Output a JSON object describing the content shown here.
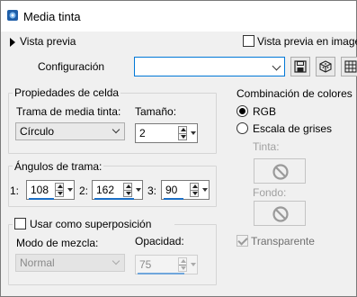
{
  "window": {
    "title": "Media tinta"
  },
  "preview": {
    "toggle_label": "Vista previa",
    "checkbox_label": "Vista previa en imagen"
  },
  "config": {
    "label": "Configuración",
    "value": ""
  },
  "cell_props": {
    "title": "Propiedades de celda",
    "trama_label": "Trama de media tinta:",
    "trama_value": "Círculo",
    "size_label": "Tamaño:",
    "size_value": "2"
  },
  "angles": {
    "title": "Ángulos de trama:",
    "items": [
      {
        "label": "1:",
        "value": "108"
      },
      {
        "label": "2:",
        "value": "162"
      },
      {
        "label": "3:",
        "value": "90"
      }
    ]
  },
  "overlay": {
    "checkbox_label": "Usar como superposición",
    "blend_label": "Modo de mezcla:",
    "blend_value": "Normal",
    "opacity_label": "Opacidad:",
    "opacity_value": "75"
  },
  "colors": {
    "title": "Combinación de colores",
    "rgb_label": "RGB",
    "grays_label": "Escala de grises",
    "tinta_label": "Tinta:",
    "fondo_label": "Fondo:",
    "transparent_label": "Transparente"
  },
  "icons": {
    "app": "app-icon",
    "save": "save-icon",
    "reset": "reset-cube-icon",
    "settings": "settings-grid-icon",
    "no_color": "no-symbol-icon"
  },
  "theme": {
    "accent": "#0078d7",
    "spin_bar": "#1b6fc6"
  }
}
